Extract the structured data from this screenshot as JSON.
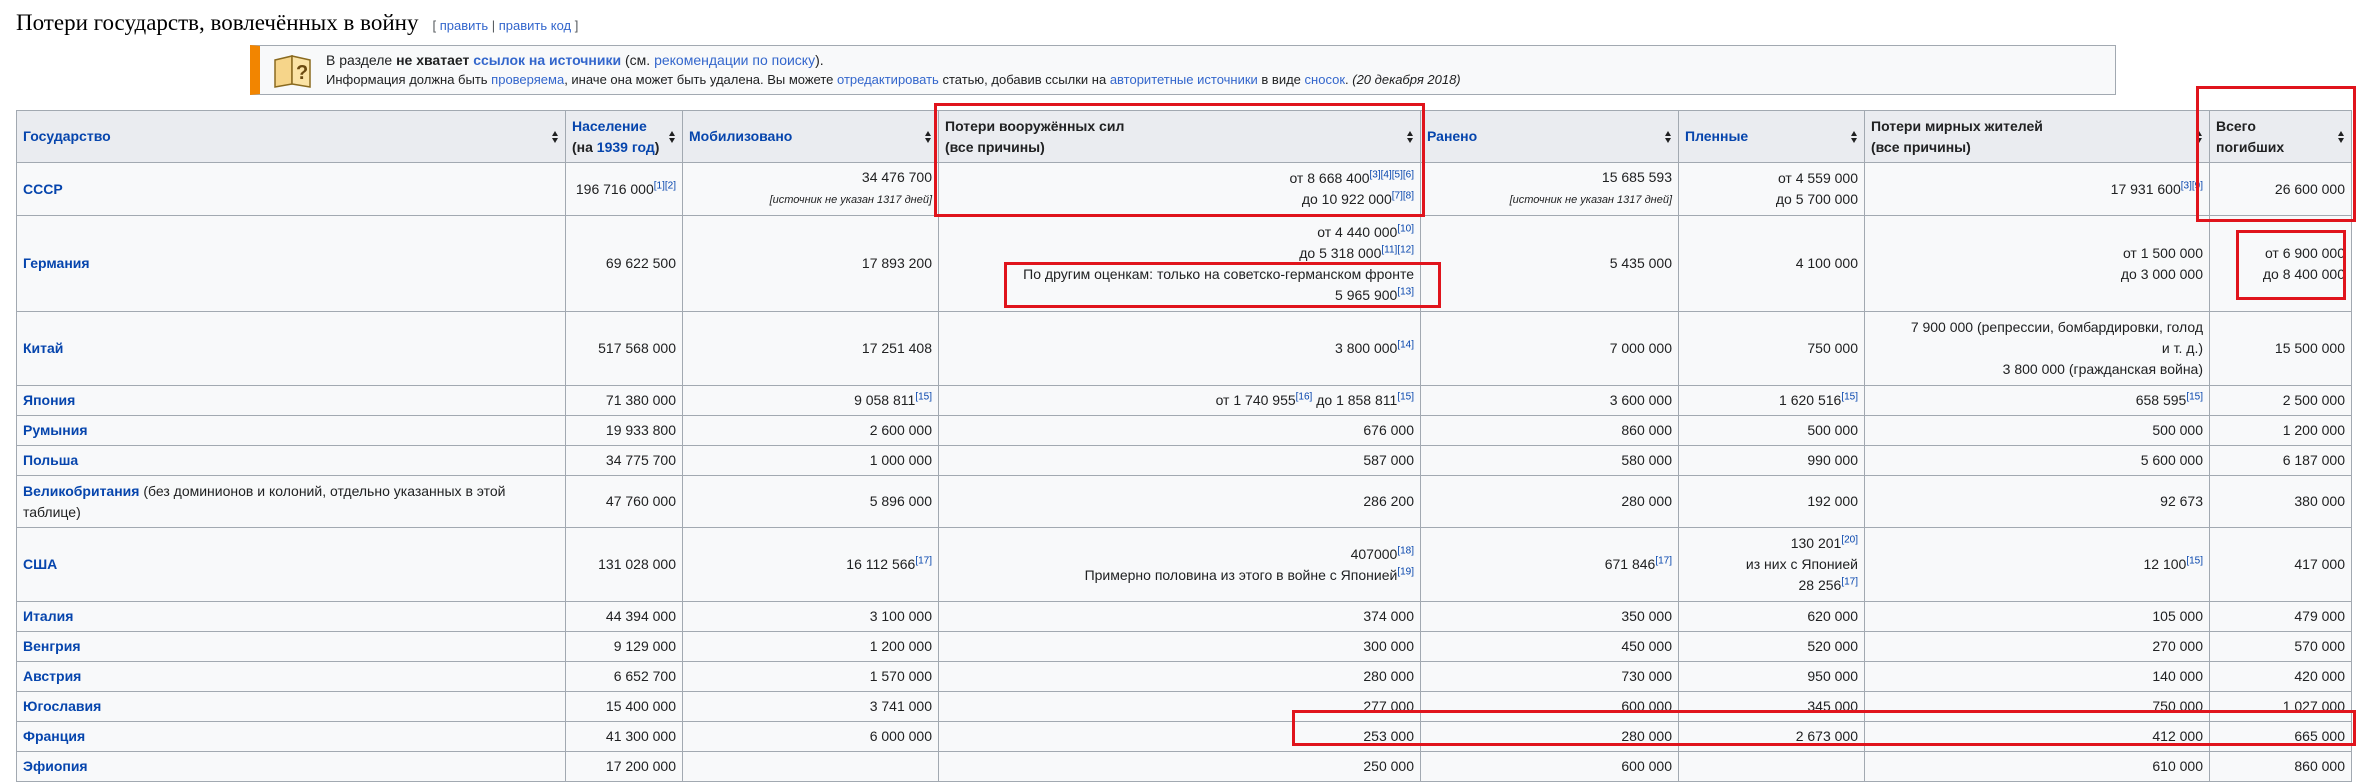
{
  "section": {
    "title": "Потери государств, вовлечённых в войну",
    "edit_open": "[",
    "edit_link": "править",
    "edit_sep": "|",
    "edit_code_link": "править код",
    "edit_close": "]"
  },
  "notice": {
    "p1": "В разделе ",
    "p2": "не хватает",
    "p3": "ссылок на источники",
    "p4": " (см. ",
    "p5": "рекомендации по поиску",
    "p6": ").",
    "q1": "Информация должна быть ",
    "q2": "проверяема",
    "q3": ", иначе она может быть удалена. Вы можете ",
    "q4": "отредактировать",
    "q5": " статью, добавив ссылки на ",
    "q6": "авторитетные источники",
    "q7": " в виде ",
    "q8": "сносок",
    "q9": ". ",
    "q10": "(20 декабря 2018)"
  },
  "headers": {
    "country": "Государство",
    "population": "Население",
    "population_sub_a": "(на ",
    "population_sub_link": "1939 год",
    "population_sub_b": ")",
    "mobilized": "Мобилизовано",
    "military_l1": "Потери вооружённых сил",
    "military_l2": "(все причины)",
    "wounded": "Ранено",
    "prisoners": "Пленные",
    "civil_l1": "Потери мирных жителей",
    "civil_l2": "(все причины)",
    "total_l1": "Всего",
    "total_l2": "погибших"
  },
  "rows": {
    "ussr": {
      "country": "СССР",
      "population": "196 716 000",
      "population_refs": "[1][2]",
      "mobilized": "34 476 700",
      "mobilized_note": "[источник не указан 1317 дней]",
      "military_a": "от 8 668 400",
      "military_a_refs": "[3][4][5][6]",
      "military_b": "до 10 922 000",
      "military_b_refs": "[7][8]",
      "wounded": "15 685 593",
      "wounded_note": "[источник не указан 1317 дней]",
      "prisoners_a": "от 4 559 000",
      "prisoners_b": "до 5 700 000",
      "civil": "17 931 600",
      "civil_refs": "[3][9]",
      "total": "26 600 000"
    },
    "germany": {
      "country": "Германия",
      "population": "69 622 500",
      "mobilized": "17 893 200",
      "military_a": "от 4 440 000",
      "military_a_refs": "[10]",
      "military_b": "до 5 318 000",
      "military_b_refs": "[11][12]",
      "military_c": "По другим оценкам: только на советско-германском фронте",
      "military_d": "5 965 900",
      "military_d_refs": "[13]",
      "wounded": "5 435 000",
      "prisoners": "4 100 000",
      "civil_a": "от 1 500 000",
      "civil_b": "до 3 000 000",
      "total_a": "от 6 900 000",
      "total_b": "до 8 400 000"
    },
    "china": {
      "country": "Китай",
      "population": "517 568 000",
      "mobilized": "17 251 408",
      "military": "3 800 000",
      "military_refs": "[14]",
      "wounded": "7 000 000",
      "prisoners": "750 000",
      "civil_a": "7 900 000 (репрессии, бомбардировки, голод",
      "civil_b": "и т. д.)",
      "civil_c": "3 800 000 (гражданская война)",
      "total": "15 500 000"
    },
    "japan": {
      "country": "Япония",
      "population": "71 380 000",
      "mobilized": "9 058 811",
      "mobilized_refs": "[15]",
      "military_a": "от 1 740 955",
      "military_a_refs": "[16]",
      "military_b": " до 1 858 811",
      "military_b_refs": "[15]",
      "wounded": "3 600 000",
      "prisoners": "1 620 516",
      "prisoners_refs": "[15]",
      "civil": "658 595",
      "civil_refs": "[15]",
      "total": "2 500 000"
    },
    "romania": {
      "country": "Румыния",
      "population": "19 933 800",
      "mobilized": "2 600 000",
      "military": "676 000",
      "wounded": "860 000",
      "prisoners": "500 000",
      "civil": "500 000",
      "total": "1 200 000"
    },
    "poland": {
      "country": "Польша",
      "population": "34 775 700",
      "mobilized": "1 000 000",
      "military": "587 000",
      "wounded": "580 000",
      "prisoners": "990 000",
      "civil": "5 600 000",
      "total": "6 187 000"
    },
    "uk": {
      "country": "Великобритания",
      "country_note": " (без доминионов и колоний, отдельно указанных в этой таблице)",
      "population": "47 760 000",
      "mobilized": "5 896 000",
      "military": "286 200",
      "wounded": "280 000",
      "prisoners": "192 000",
      "civil": "92 673",
      "total": "380 000"
    },
    "usa": {
      "country": "США",
      "population": "131 028 000",
      "mobilized": "16 112 566",
      "mobilized_refs": "[17]",
      "military_a": "407000",
      "military_a_refs": "[18]",
      "military_b": "Примерно половина из этого в войне с Японией",
      "military_b_refs": "[19]",
      "wounded": "671 846",
      "wounded_refs": "[17]",
      "prisoners_a": "130 201",
      "prisoners_a_refs": "[20]",
      "prisoners_b": "из них с Японией",
      "prisoners_c": "28 256",
      "prisoners_c_refs": "[17]",
      "civil": "12 100",
      "civil_refs": "[15]",
      "total": "417 000"
    },
    "italy": {
      "country": "Италия",
      "population": "44 394 000",
      "mobilized": "3 100 000",
      "military": "374 000",
      "wounded": "350 000",
      "prisoners": "620 000",
      "civil": "105 000",
      "total": "479 000"
    },
    "hungary": {
      "country": "Венгрия",
      "population": "9 129 000",
      "mobilized": "1 200 000",
      "military": "300 000",
      "wounded": "450 000",
      "prisoners": "520 000",
      "civil": "270 000",
      "total": "570 000"
    },
    "austria": {
      "country": "Австрия",
      "population": "6 652 700",
      "mobilized": "1 570 000",
      "military": "280 000",
      "wounded": "730 000",
      "prisoners": "950 000",
      "civil": "140 000",
      "total": "420 000"
    },
    "yugoslavia": {
      "country": "Югославия",
      "population": "15 400 000",
      "mobilized": "3 741 000",
      "military": "277 000",
      "wounded": "600 000",
      "prisoners": "345 000",
      "civil": "750 000",
      "total": "1 027 000"
    },
    "france": {
      "country": "Франция",
      "population": "41 300 000",
      "mobilized": "6 000 000",
      "military": "253 000",
      "wounded": "280 000",
      "prisoners": "2 673 000",
      "civil": "412 000",
      "total": "665 000"
    },
    "ethiopia": {
      "country": "Эфиопия",
      "population": "17 200 000",
      "mobilized": "",
      "military": "250 000",
      "wounded": "600 000",
      "prisoners": "",
      "civil": "610 000",
      "total": "860 000"
    }
  },
  "colors": {
    "link": "#0645ad",
    "highlight": "#e0141c",
    "notice_accent": "#f28500",
    "header_bg": "#eaecf0"
  }
}
